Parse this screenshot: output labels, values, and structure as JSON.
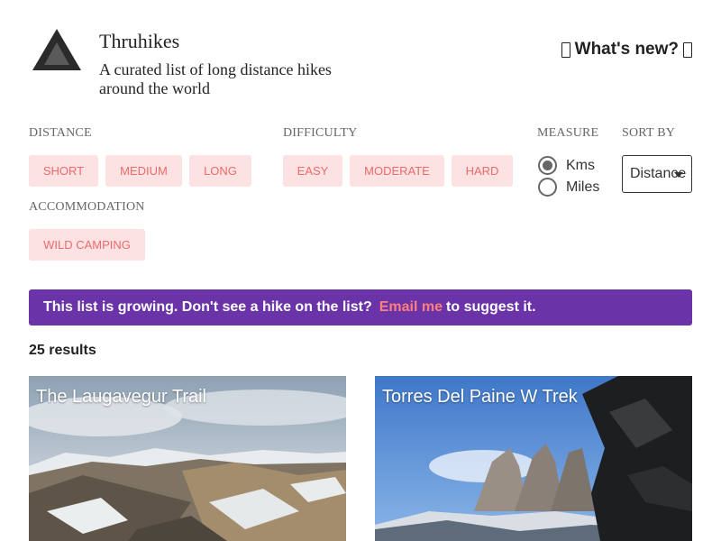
{
  "header": {
    "logo_icon": "mountain-icon",
    "title": "Thruhikes",
    "tagline": "A curated list of long distance hikes around the world",
    "whats_new_label": "What's new?"
  },
  "filters": {
    "distance": {
      "label": "DISTANCE",
      "options": [
        "SHORT",
        "MEDIUM",
        "LONG"
      ]
    },
    "difficulty": {
      "label": "DIFFICULTY",
      "options": [
        "EASY",
        "MODERATE",
        "HARD"
      ]
    },
    "accommodation": {
      "label": "ACCOMMODATION",
      "options": [
        "WILD CAMPING"
      ]
    },
    "measure": {
      "label": "MEASURE",
      "options": [
        "Kms",
        "Miles"
      ],
      "selected": "Kms"
    },
    "sort": {
      "label": "SORT BY",
      "selected": "Distance"
    }
  },
  "banner": {
    "text": "This list is growing. Don't see a hike on the list?",
    "link_label": "Email me",
    "suffix": "to suggest it."
  },
  "results": {
    "count_label": "25 results"
  },
  "cards": [
    {
      "title": "The Laugavegur Trail"
    },
    {
      "title": "Torres Del Paine W Trek"
    }
  ],
  "colors": {
    "chip_bg": "#fde2e4",
    "chip_text": "#ee6a6a",
    "banner_bg": "#6a34a8",
    "banner_link": "#ff7f7f"
  }
}
